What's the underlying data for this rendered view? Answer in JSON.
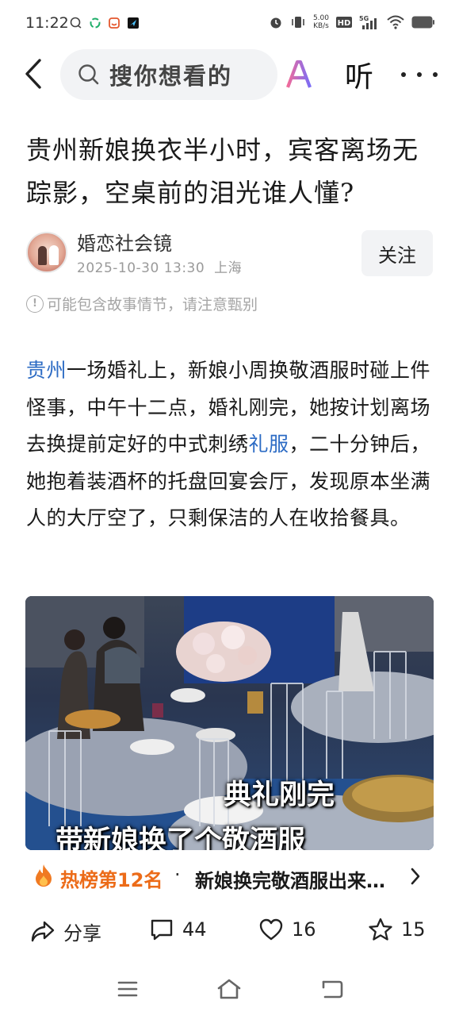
{
  "status_bar": {
    "time": "11:22",
    "net_speed_value": "5.00",
    "net_speed_unit": "KB/s",
    "hd_label": "HD",
    "network": "5G",
    "left_icons": [
      "chat-bubble-icon",
      "recycle-icon",
      "app-icon",
      "send-icon"
    ],
    "right_icons": [
      "alarm-icon",
      "vibrate-icon",
      "signal-icon",
      "wifi-icon",
      "battery-icon"
    ]
  },
  "nav": {
    "search_placeholder": "搜你想看的",
    "ai_label": "AI",
    "listen_label": "听",
    "icons": [
      "back-icon",
      "search-icon",
      "more-icon"
    ]
  },
  "article": {
    "title": "贵州新娘换衣半小时，宾客离场无踪影，空桌前的泪光谁人懂?",
    "author": "婚恋社会镜",
    "date": "2025-10-30  13:30",
    "location": "上海",
    "follow_label": "关注",
    "notice": "可能包含故事情节，请注意甄别",
    "body": {
      "link1": "贵州",
      "part1": "一场婚礼上，新娘小周换敬酒服时碰上件怪事，中午十二点，婚礼刚完，她按计划离场去换提前定好的中式刺绣",
      "link2": "礼服",
      "part2": "，二十分钟后，她抱着装酒杯的托盘回宴会厅，发现原本坐满人的大厅空了，只剩保洁的人在收拾餐具。"
    },
    "image_caption_1": "典礼刚完",
    "image_caption_2": "带新娘换了个敬酒服"
  },
  "hot": {
    "rank": "热榜第12名",
    "separator": "·",
    "headline": "新娘换完敬酒服出来…"
  },
  "actions": {
    "share_label": "分享",
    "comments": "44",
    "likes": "16",
    "favorites": "15"
  },
  "colors": {
    "accent_link": "#2c6bc4",
    "hot_orange": "#ec6b18",
    "ai_gradient_start": "#f06b9a",
    "ai_gradient_end": "#7b6cf6"
  }
}
